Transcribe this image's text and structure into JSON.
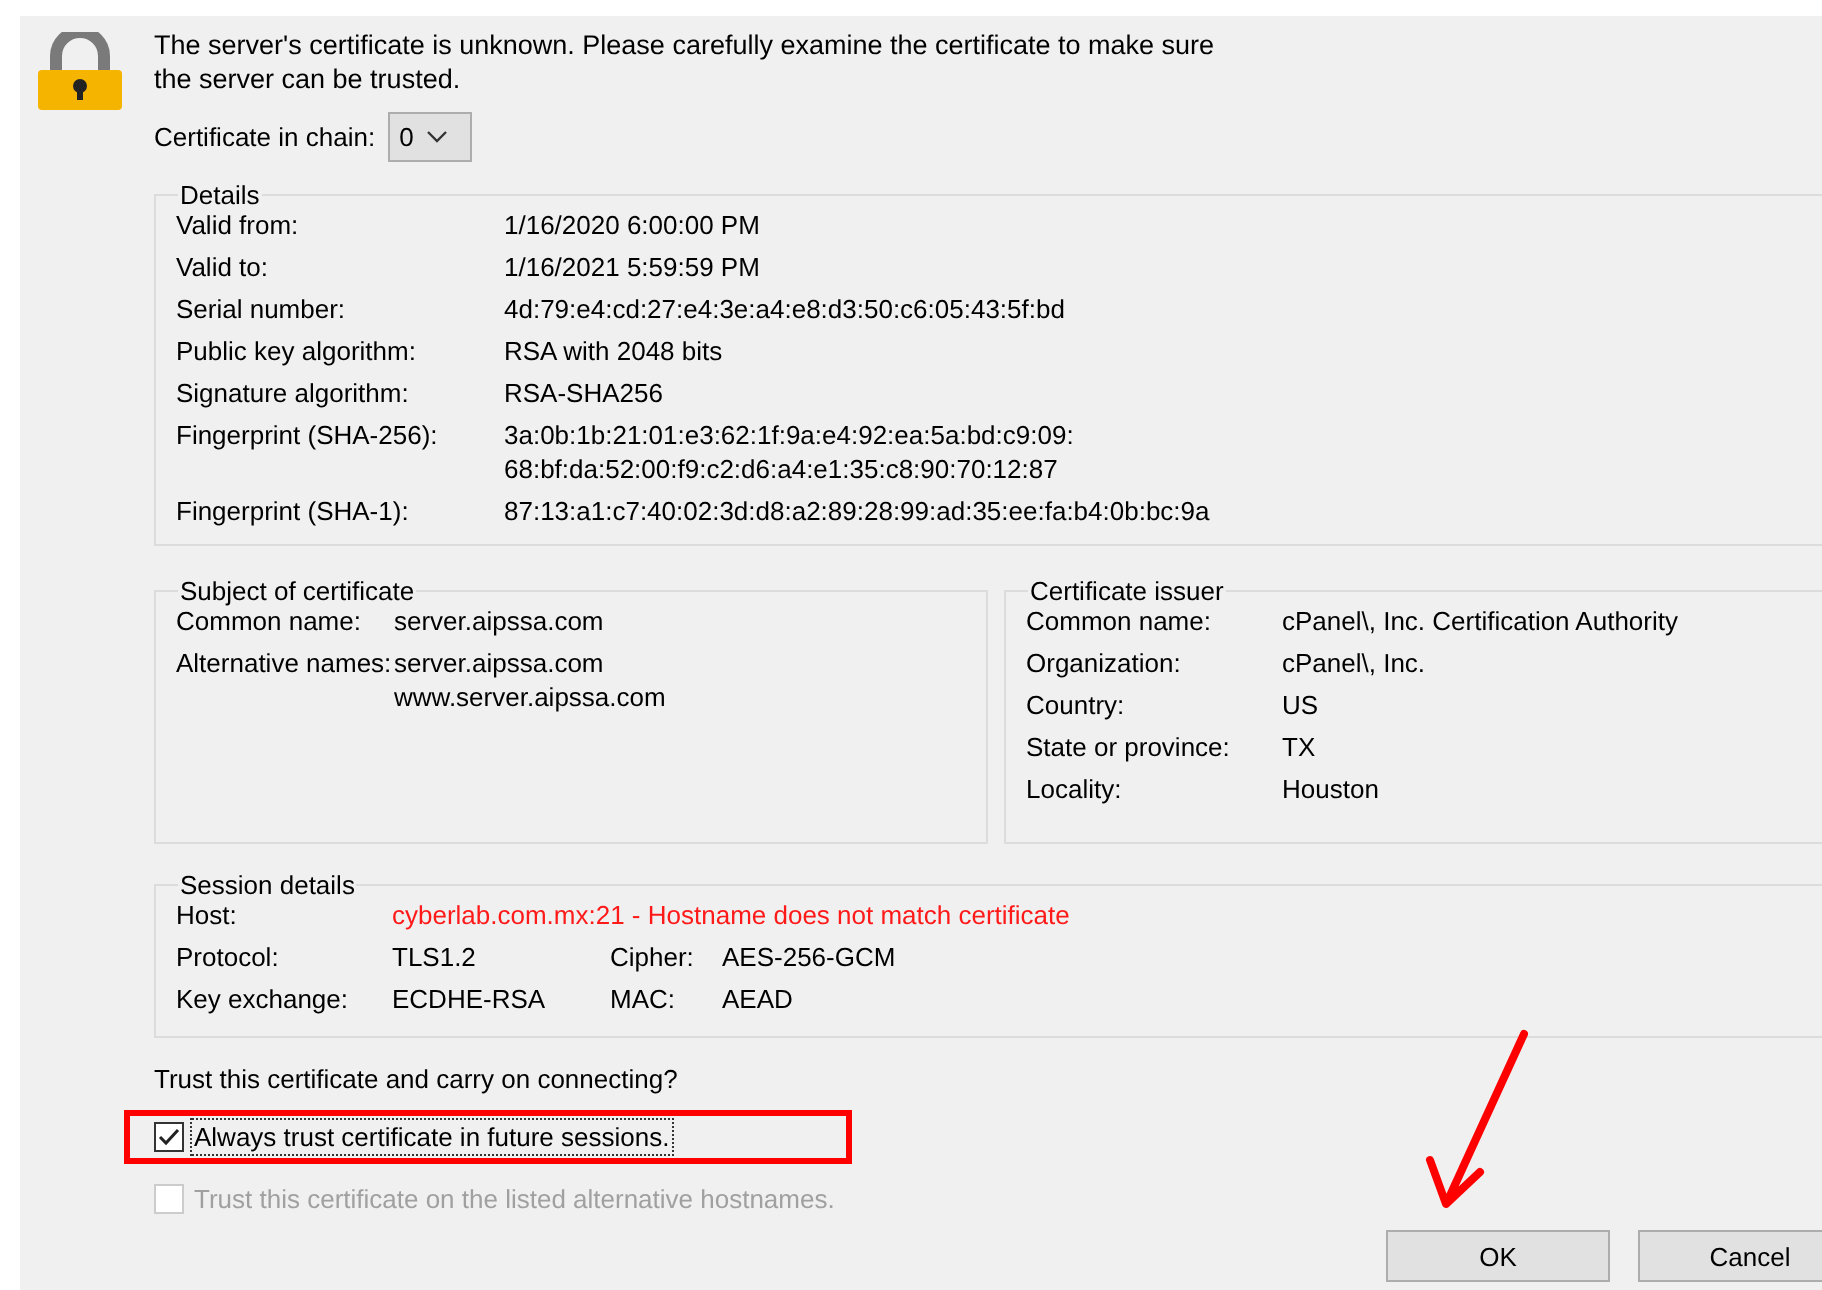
{
  "message": "The server's certificate is unknown. Please carefully examine the certificate to make sure the server can be trusted.",
  "chain": {
    "label": "Certificate in chain:",
    "value": "0"
  },
  "details": {
    "title": "Details",
    "rows": [
      {
        "label": "Valid from:",
        "values": [
          "1/16/2020 6:00:00 PM"
        ]
      },
      {
        "label": "Valid to:",
        "values": [
          "1/16/2021 5:59:59 PM"
        ]
      },
      {
        "label": "Serial number:",
        "values": [
          "4d:79:e4:cd:27:e4:3e:a4:e8:d3:50:c6:05:43:5f:bd"
        ]
      },
      {
        "label": "Public key algorithm:",
        "values": [
          "RSA with 2048 bits"
        ]
      },
      {
        "label": "Signature algorithm:",
        "values": [
          "RSA-SHA256"
        ]
      },
      {
        "label": "Fingerprint (SHA-256):",
        "values": [
          "3a:0b:1b:21:01:e3:62:1f:9a:e4:92:ea:5a:bd:c9:09:",
          "68:bf:da:52:00:f9:c2:d6:a4:e1:35:c8:90:70:12:87"
        ]
      },
      {
        "label": "Fingerprint (SHA-1):",
        "values": [
          "87:13:a1:c7:40:02:3d:d8:a2:89:28:99:ad:35:ee:fa:b4:0b:bc:9a"
        ]
      }
    ]
  },
  "subject": {
    "title": "Subject of certificate",
    "rows": [
      {
        "label": "Common name:",
        "values": [
          "server.aipssa.com"
        ]
      },
      {
        "label": "Alternative names:",
        "values": [
          "server.aipssa.com",
          "www.server.aipssa.com"
        ]
      }
    ]
  },
  "issuer": {
    "title": "Certificate issuer",
    "rows": [
      {
        "label": "Common name:",
        "values": [
          "cPanel\\, Inc. Certification Authority"
        ]
      },
      {
        "label": "Organization:",
        "values": [
          "cPanel\\, Inc."
        ]
      },
      {
        "label": "Country:",
        "values": [
          "US"
        ]
      },
      {
        "label": "State or province:",
        "values": [
          "TX"
        ]
      },
      {
        "label": "Locality:",
        "values": [
          "Houston"
        ]
      }
    ]
  },
  "session": {
    "title": "Session details",
    "rows": [
      {
        "label": "Host:",
        "value": "cyberlab.com.mx:21 - Hostname does not match certificate",
        "warning": true
      },
      {
        "label": "Protocol:",
        "value": "TLS1.2",
        "warning": false,
        "extra_label": "Cipher:",
        "extra_value": "AES-256-GCM"
      },
      {
        "label": "Key exchange:",
        "value": "ECDHE-RSA",
        "warning": false,
        "extra_label": "MAC:",
        "extra_value": "AEAD"
      }
    ]
  },
  "trust_question": "Trust this certificate and carry on connecting?",
  "checkboxes": [
    {
      "label": "Always trust certificate in future sessions.",
      "checked": true,
      "disabled": false,
      "focused": true,
      "highlighted": true
    },
    {
      "label": "Trust this certificate on the listed alternative hostnames.",
      "checked": false,
      "disabled": true,
      "focused": false,
      "highlighted": false
    }
  ],
  "buttons": [
    "OK",
    "Cancel"
  ]
}
